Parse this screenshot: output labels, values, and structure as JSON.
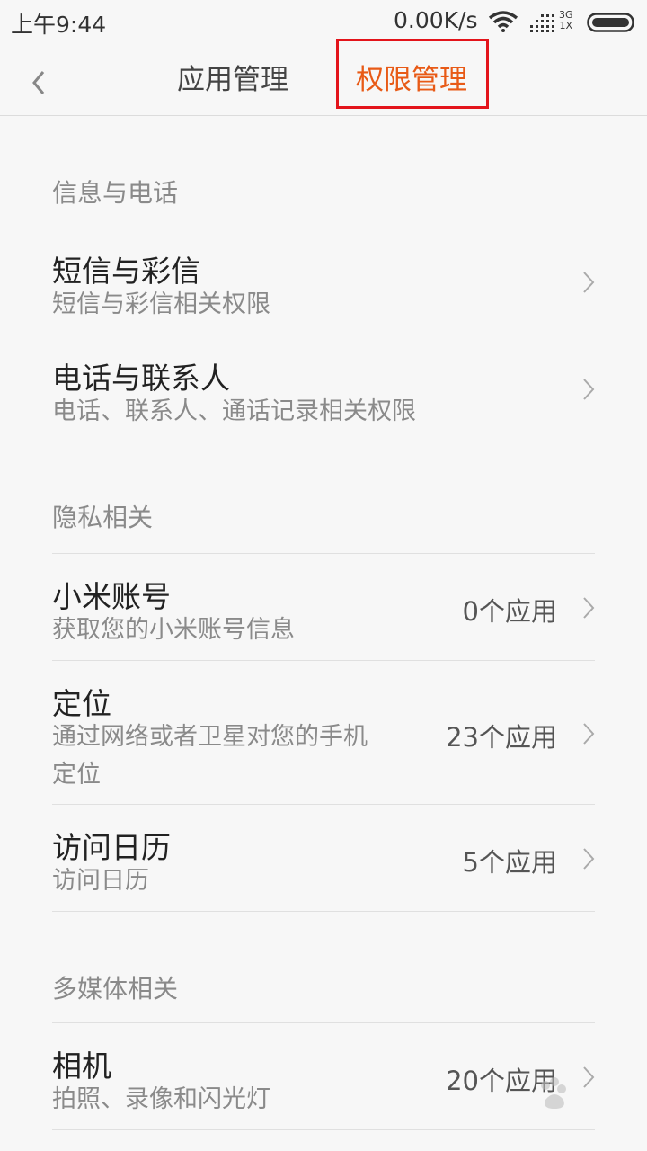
{
  "status_bar": {
    "time": "上午9:44",
    "speed": "0.00K/s",
    "network_top": "3G",
    "network_bottom": "1X"
  },
  "title_bar": {
    "tab_app_management": "应用管理",
    "tab_permission_management": "权限管理",
    "active_color": "#e85a16",
    "highlight_box_color": "#e3141b"
  },
  "sections": [
    {
      "header": "信息与电话",
      "items": [
        {
          "title": "短信与彩信",
          "subtitle": "短信与彩信相关权限",
          "count": ""
        },
        {
          "title": "电话与联系人",
          "subtitle": "电话、联系人、通话记录相关权限",
          "count": ""
        }
      ]
    },
    {
      "header": "隐私相关",
      "items": [
        {
          "title": "小米账号",
          "subtitle": "获取您的小米账号信息",
          "count": "0个应用"
        },
        {
          "title": "定位",
          "subtitle_line1": "通过网络或者卫星对您的手机",
          "subtitle_line2": "定位",
          "count": "23个应用"
        },
        {
          "title": "访问日历",
          "subtitle": "访问日历",
          "count": "5个应用"
        }
      ]
    },
    {
      "header": "多媒体相关",
      "items": [
        {
          "title": "相机",
          "subtitle": "拍照、录像和闪光灯",
          "count": "20个应用"
        }
      ]
    }
  ]
}
